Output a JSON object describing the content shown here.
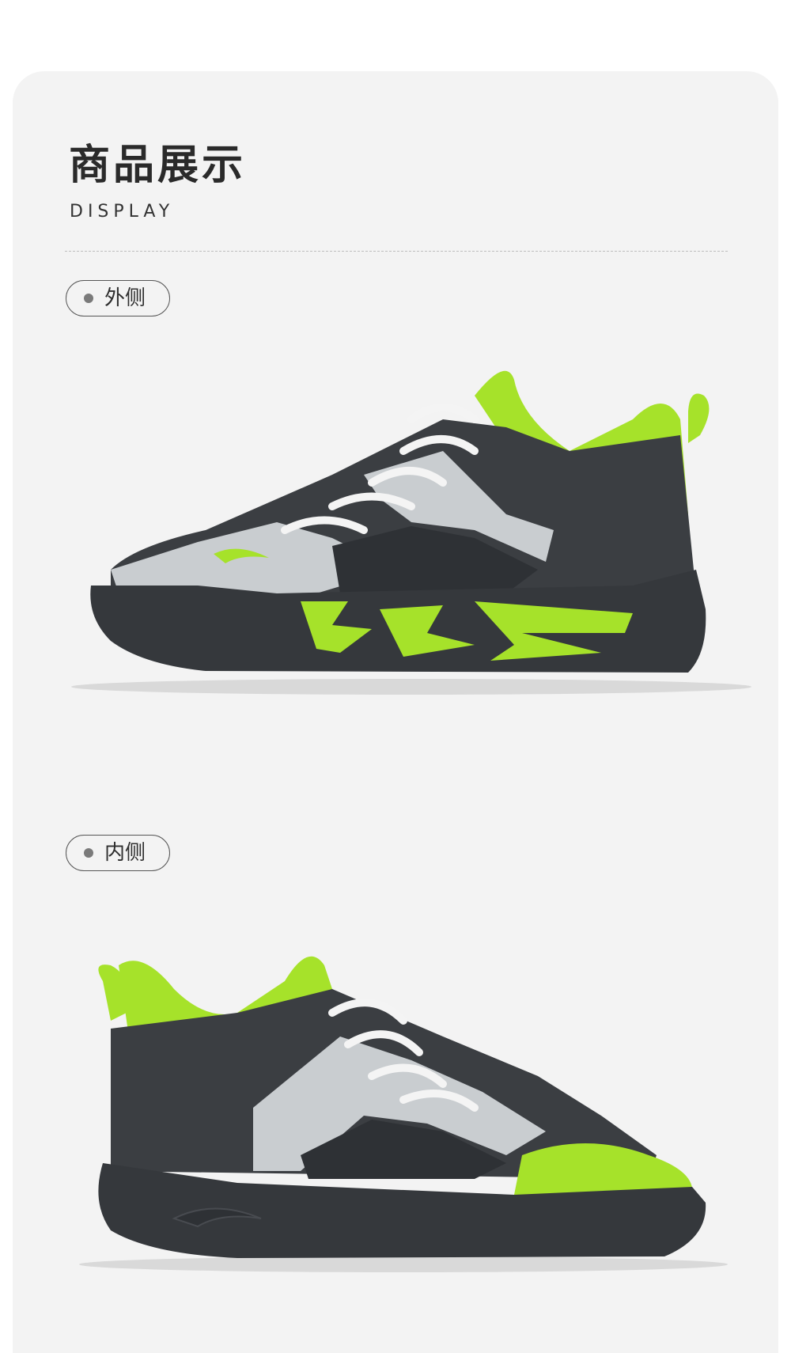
{
  "section": {
    "title": "商品展示",
    "subtitle": "DISPLAY"
  },
  "views": [
    {
      "label": "外侧"
    },
    {
      "label": "内侧"
    }
  ],
  "colors": {
    "accent_green": "#a6e22a",
    "charcoal": "#3b3e42",
    "silver": "#c9cdd0",
    "panel_bg": "#f3f3f3"
  },
  "icons": {
    "bullet": "dot-icon"
  }
}
